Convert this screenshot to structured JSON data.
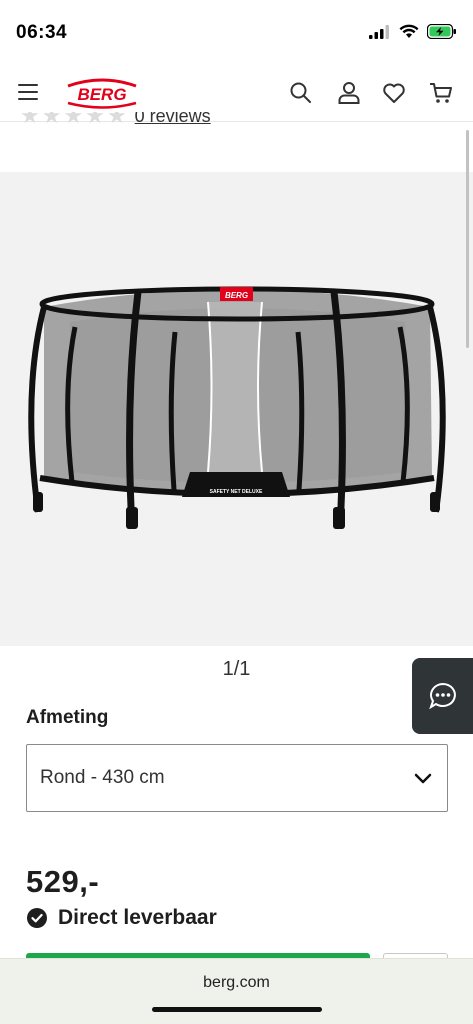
{
  "status_bar": {
    "time": "06:34",
    "icons": [
      "signal-icon",
      "wifi-icon",
      "battery-charging-icon"
    ]
  },
  "header": {
    "logo_text": "BERG",
    "icons": [
      "menu-icon",
      "search-icon",
      "account-icon",
      "wishlist-icon",
      "cart-icon"
    ]
  },
  "reviews": {
    "stars_filled": 0,
    "stars_total": 5,
    "label": "0 reviews"
  },
  "product_image": {
    "net_label": "SAFETY NET DELUXE",
    "brand_tag": "BERG"
  },
  "gallery": {
    "pager": "1/1"
  },
  "size": {
    "label": "Afmeting",
    "selected": "Rond - 430 cm"
  },
  "price": "529,-",
  "availability": "Direct leverbaar",
  "browser": {
    "url": "berg.com"
  },
  "colors": {
    "brand_red": "#e2001a",
    "action_green": "#1ca84a",
    "chat_bg": "#2f3437",
    "text": "#1e1e1e"
  }
}
